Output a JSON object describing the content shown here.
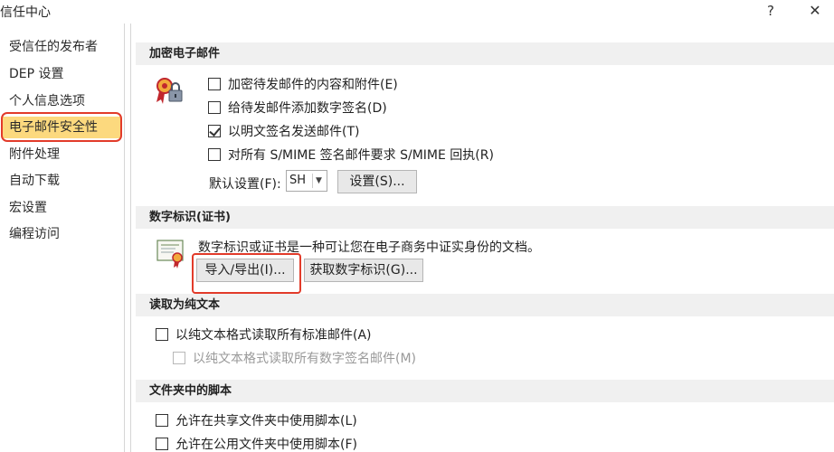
{
  "window": {
    "title": "信任中心",
    "help_label": "?",
    "close_label": "✕"
  },
  "sidebar": {
    "items": [
      {
        "label": "受信任的发布者"
      },
      {
        "label": "DEP 设置"
      },
      {
        "label": "个人信息选项"
      },
      {
        "label": "电子邮件安全性",
        "selected": true
      },
      {
        "label": "附件处理"
      },
      {
        "label": "自动下载"
      },
      {
        "label": "宏设置"
      },
      {
        "label": "编程访问"
      }
    ]
  },
  "encrypted_email": {
    "heading": "加密电子邮件",
    "icon": "certificate-lock-icon",
    "options": [
      {
        "label": "加密待发邮件的内容和附件(E)",
        "checked": false
      },
      {
        "label": "给待发邮件添加数字签名(D)",
        "checked": false
      },
      {
        "label": "以明文签名发送邮件(T)",
        "checked": true
      },
      {
        "label": "对所有 S/MIME 签名邮件要求 S/MIME 回执(R)",
        "checked": false
      }
    ],
    "default_setting_label": "默认设置(F):",
    "default_setting_value": "SH",
    "settings_button": "设置(S)..."
  },
  "digital_id": {
    "heading": "数字标识(证书)",
    "icon": "certificate-icon",
    "description": "数字标识或证书是一种可让您在电子商务中证实身份的文档。",
    "import_export_button": "导入/导出(I)...",
    "get_id_button": "获取数字标识(G)..."
  },
  "read_plain_text": {
    "heading": "读取为纯文本",
    "options": [
      {
        "label": "以纯文本格式读取所有标准邮件(A)",
        "checked": false,
        "disabled": false
      },
      {
        "label": "以纯文本格式读取所有数字签名邮件(M)",
        "checked": false,
        "disabled": true
      }
    ]
  },
  "folder_scripts": {
    "heading": "文件夹中的脚本",
    "options": [
      {
        "label": "允许在共享文件夹中使用脚本(L)",
        "checked": false
      },
      {
        "label": "允许在公用文件夹中使用脚本(F)",
        "checked": false
      }
    ]
  },
  "colors": {
    "selected_bg": "#fcd97e",
    "highlight_frame": "#e23b2a",
    "section_bg": "#f0f0f0"
  }
}
